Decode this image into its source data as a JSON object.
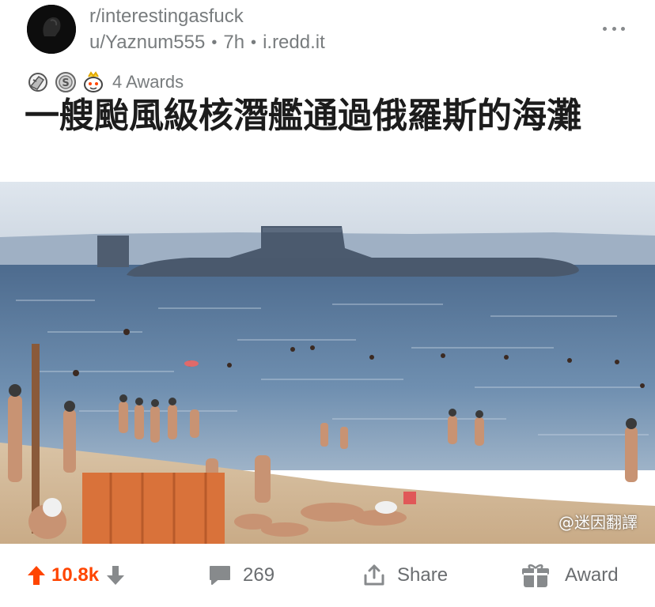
{
  "post": {
    "subreddit": "r/interestingasfuck",
    "author": "u/Yaznum555",
    "age": "7h",
    "domain": "i.redd.it",
    "awards_label": "4 Awards",
    "title": "一艘颱風級核潛艦通過俄羅斯的海灘",
    "watermark": "@迷因翻譯"
  },
  "actions": {
    "votes": "10.8k",
    "comments": "269",
    "share_label": "Share",
    "award_label": "Award"
  },
  "colors": {
    "upvote": "#ff4500",
    "muted": "#787c7e",
    "text": "#1c1c1c"
  },
  "icons": [
    "snoo-avatar-icon",
    "more-dots-icon",
    "award-facepalm-icon",
    "award-silver-icon",
    "award-wholesome-icon",
    "upvote-arrow-icon",
    "downvote-arrow-icon",
    "comment-bubble-icon",
    "share-icon",
    "award-gift-icon"
  ]
}
